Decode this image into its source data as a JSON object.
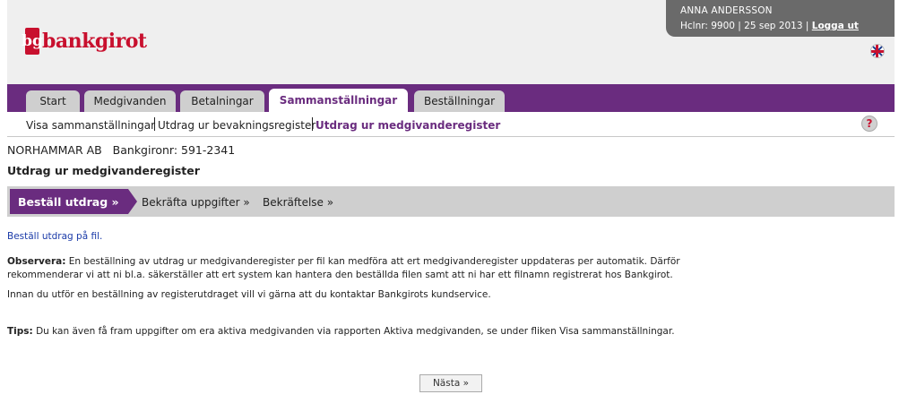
{
  "brand": {
    "logo_text": "bankgirot",
    "logo_mark": "bg",
    "color": "#c8102e"
  },
  "user": {
    "name": "ANNA ANDERSSON",
    "info": "Hclnr: 9900 | 25 sep 2013 |",
    "logout_label": "Logga ut"
  },
  "language_icon": "uk-flag-icon",
  "tabs": [
    {
      "label": "Start"
    },
    {
      "label": "Medgivanden"
    },
    {
      "label": "Betalningar"
    },
    {
      "label": "Sammanställningar",
      "active": true
    },
    {
      "label": "Beställningar"
    }
  ],
  "subnav": [
    {
      "label": "Visa sammanställningar"
    },
    {
      "label": "Utdrag ur bevakningsregister"
    },
    {
      "label": "Utdrag ur medgivanderegister",
      "active": true
    }
  ],
  "help_label": "?",
  "company": {
    "name": "NORHAMMAR AB",
    "bankgiro": "Bankgironr: 591-2341"
  },
  "page_title": "Utdrag ur medgivanderegister",
  "steps": [
    {
      "label": "Beställ utdrag »",
      "active": true
    },
    {
      "label": "Bekräfta uppgifter »"
    },
    {
      "label": "Bekräftelse »"
    }
  ],
  "content": {
    "link": "Beställ utdrag på fil.",
    "observe_label": "Observera:",
    "observe_line1": "En beställning av utdrag ur medgivanderegister per fil kan medföra att ert medgivanderegister uppdateras per automatik. Därför",
    "observe_line2": "rekommenderar vi att ni bl.a. säkerställer att ert system kan hantera den beställda filen samt att ni har ett filnamn registrerat hos Bankgirot.",
    "contact": "Innan du utför en beställning av registerutdraget vill vi gärna att du kontaktar Bankgirots kundservice.",
    "tips_label": "Tips:",
    "tips": "Du kan även få fram uppgifter om era aktiva medgivanden via rapporten Aktiva medgivanden, se under fliken Visa sammanställningar."
  },
  "next_button": "Nästa »",
  "colors": {
    "purple": "#6a2c7f",
    "header_bg": "#efefef",
    "user_bg": "#6a6a6a",
    "tab_bg": "#cfcfcf"
  }
}
